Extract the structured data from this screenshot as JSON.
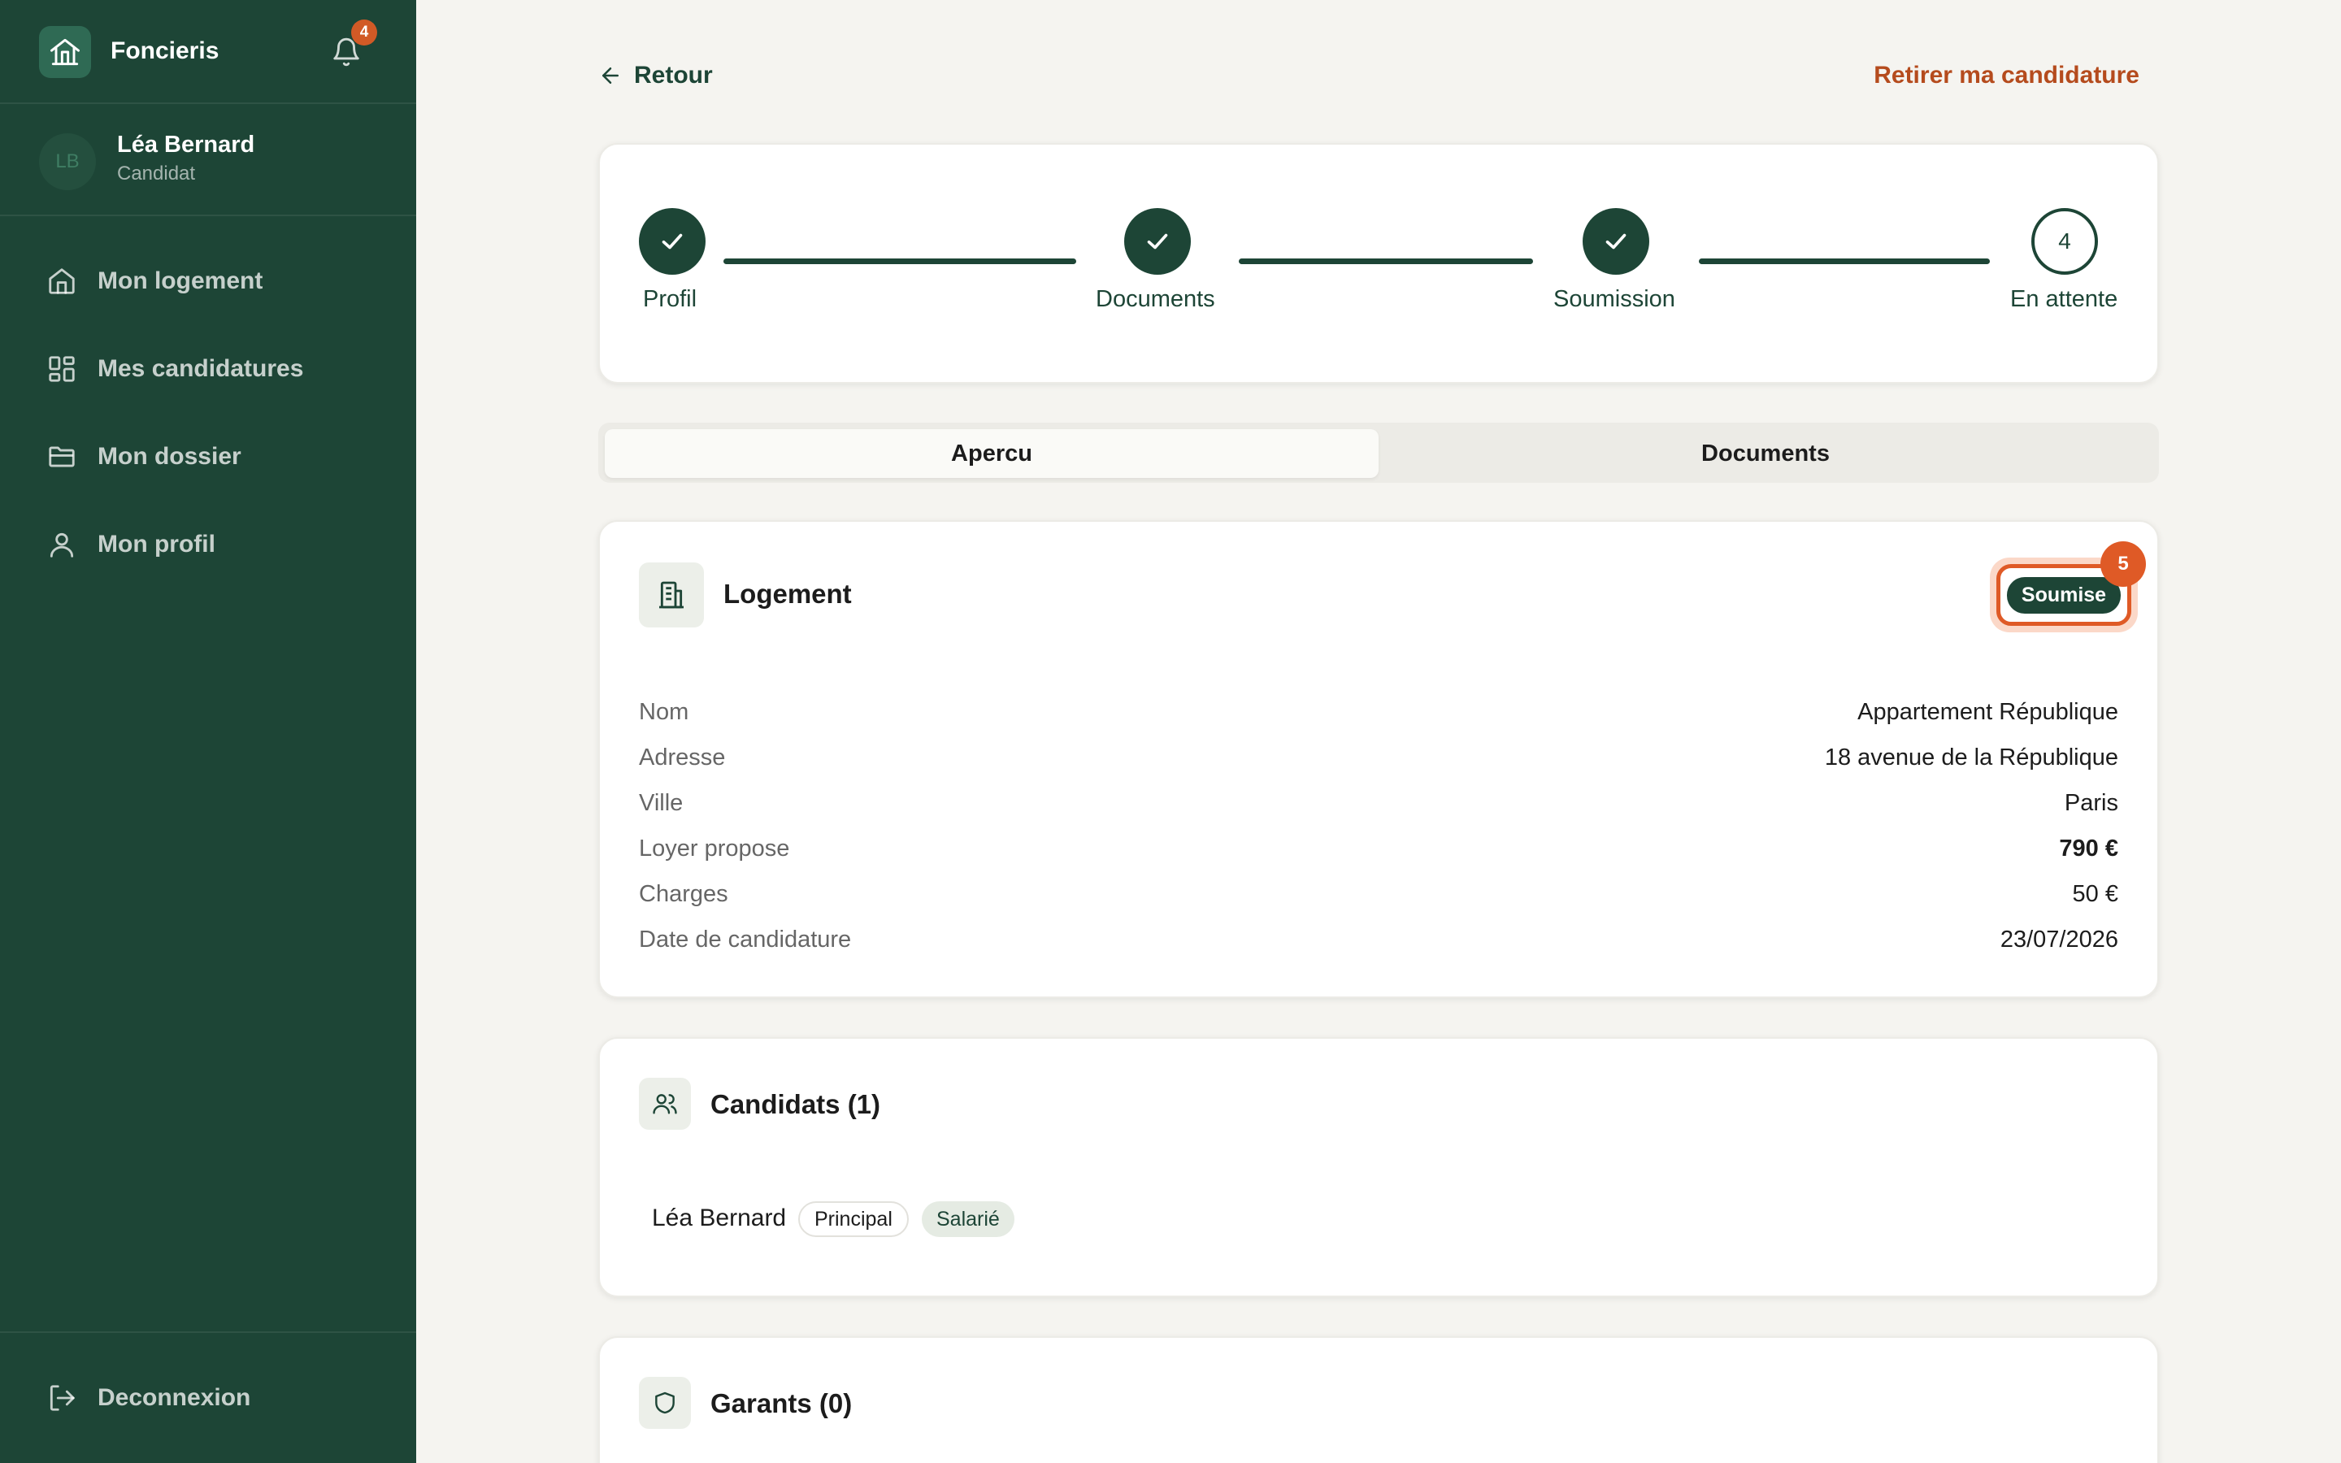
{
  "app": {
    "name": "Foncieris",
    "notification_count": "4"
  },
  "user": {
    "initials": "LB",
    "name": "Léa Bernard",
    "role": "Candidat"
  },
  "nav": {
    "items": [
      {
        "label": "Mon logement",
        "icon": "home-icon"
      },
      {
        "label": "Mes candidatures",
        "icon": "grid-icon"
      },
      {
        "label": "Mon dossier",
        "icon": "folder-icon"
      },
      {
        "label": "Mon profil",
        "icon": "user-icon"
      }
    ],
    "logout": "Deconnexion"
  },
  "header": {
    "back_label": "Retour",
    "withdraw_label": "Retirer ma candidature"
  },
  "stepper": {
    "steps": [
      {
        "label": "Profil",
        "state": "done"
      },
      {
        "label": "Documents",
        "state": "done"
      },
      {
        "label": "Soumission",
        "state": "done"
      },
      {
        "label": "En attente",
        "state": "pending",
        "number": "4"
      }
    ]
  },
  "tabs": [
    {
      "label": "Apercu",
      "active": true
    },
    {
      "label": "Documents",
      "active": false
    }
  ],
  "logement": {
    "title": "Logement",
    "status": "Soumise",
    "status_marker": "5",
    "rows": [
      {
        "label": "Nom",
        "value": "Appartement République"
      },
      {
        "label": "Adresse",
        "value": "18 avenue de la République"
      },
      {
        "label": "Ville",
        "value": "Paris"
      },
      {
        "label": "Loyer propose",
        "value": "790 €"
      },
      {
        "label": "Charges",
        "value": "50 €"
      },
      {
        "label": "Date de candidature",
        "value": "23/07/2026"
      }
    ]
  },
  "candidats": {
    "title": "Candidats (1)",
    "list": [
      {
        "name": "Léa Bernard",
        "tags": [
          "Principal",
          "Salarié"
        ]
      }
    ]
  },
  "garants": {
    "title": "Garants (0)"
  },
  "colors": {
    "sidebar": "#1d4536",
    "accent": "#df5a26",
    "withdraw": "#b54b1d",
    "background": "#f5f4f0"
  }
}
